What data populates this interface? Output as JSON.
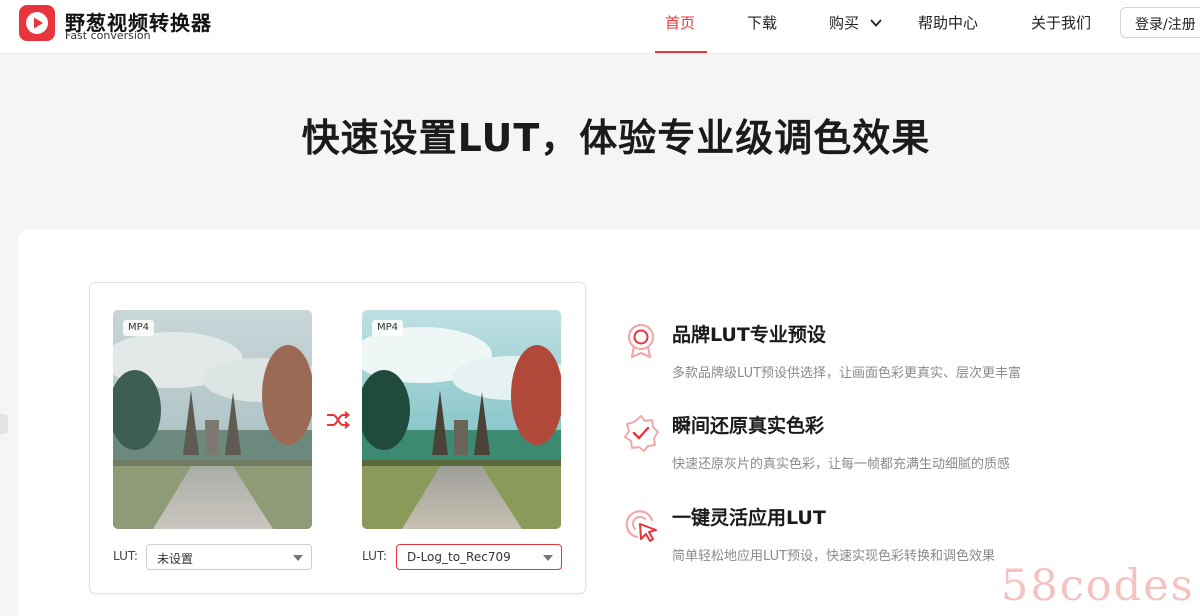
{
  "brand": {
    "name": "野葱视频转换器",
    "subtitle": "Fast conversion",
    "accent_color": "#e8343c"
  },
  "nav": {
    "items": [
      {
        "label": "首页",
        "active": true
      },
      {
        "label": "下载",
        "active": false
      },
      {
        "label": "购买",
        "active": false,
        "has_dropdown": true
      },
      {
        "label": "帮助中心",
        "active": false
      },
      {
        "label": "关于我们",
        "active": false
      }
    ],
    "login_label": "登录/注册"
  },
  "hero": {
    "title": "快速设置LUT，体验专业级调色效果"
  },
  "demo": {
    "left": {
      "format_badge": "MP4",
      "lut_label": "LUT:",
      "lut_value": "未设置"
    },
    "right": {
      "format_badge": "MP4",
      "lut_label": "LUT:",
      "lut_value": "D-Log_to_Rec709"
    },
    "swap_icon": "shuffle-icon"
  },
  "features": [
    {
      "icon": "award-badge-icon",
      "title": "品牌LUT专业预设",
      "description": "多款品牌级LUT预设供选择，让画面色彩更真实、层次更丰富"
    },
    {
      "icon": "star-badge-icon",
      "title": "瞬间还原真实色彩",
      "description": "快速还原灰片的真实色彩，让每一帧都充满生动细腻的质感"
    },
    {
      "icon": "click-cursor-icon",
      "title": "一键灵活应用LUT",
      "description": "简单轻松地应用LUT预设，快速实现色彩转换和调色效果"
    }
  ],
  "watermark": "58codes"
}
